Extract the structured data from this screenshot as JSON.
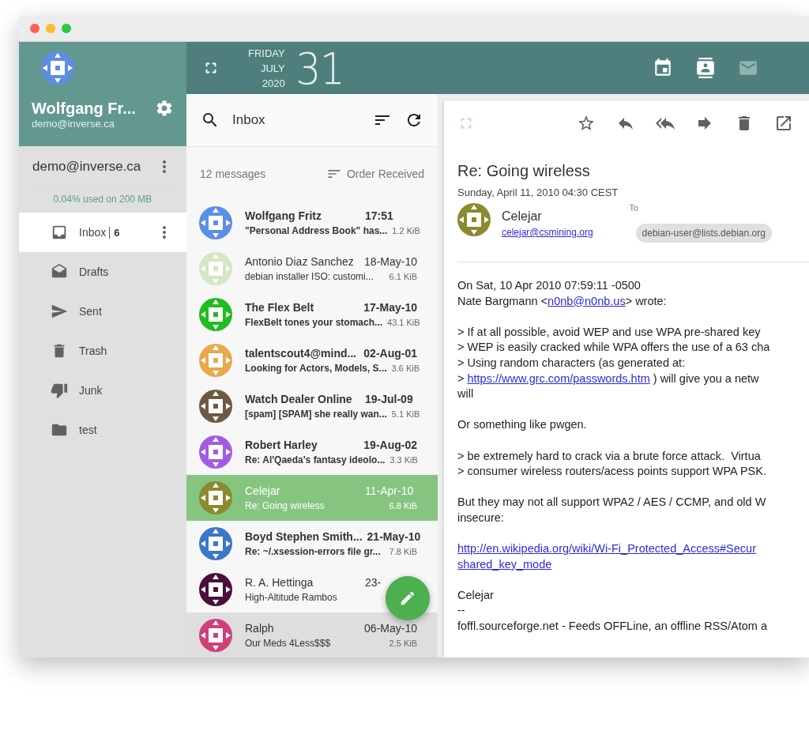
{
  "account_header": {
    "display_name": "Wolfgang Fr...",
    "email": "demo@inverse.ca"
  },
  "calendar": {
    "weekday": "FRIDAY",
    "month": "JULY",
    "year": "2020",
    "day": "31"
  },
  "app_switcher": [
    {
      "kind": "calendar",
      "selected": false
    },
    {
      "kind": "contacts",
      "selected": false
    },
    {
      "kind": "mail",
      "selected": true
    }
  ],
  "account": {
    "name": "demo@inverse.ca",
    "quota": {
      "level": 0.0004,
      "label": "0.04% used on 200 MB"
    }
  },
  "folders": [
    {
      "kind": "inbox",
      "label": "Inbox",
      "count": "6",
      "selected": true
    },
    {
      "kind": "drafts",
      "label": "Drafts",
      "selected": false
    },
    {
      "kind": "sent",
      "label": "Sent",
      "selected": false
    },
    {
      "kind": "trash",
      "label": "Trash",
      "selected": false
    },
    {
      "kind": "junk",
      "label": "Junk",
      "selected": false
    },
    {
      "kind": "folder",
      "label": "test",
      "selected": false
    }
  ],
  "list_toolbar": {
    "title": "Inbox"
  },
  "list_info": {
    "count": "12 messages",
    "sort": "Order Received"
  },
  "messages": [
    {
      "sender": "Wolfgang Fritz",
      "date": "17:51",
      "subject": "\"Personal Address Book\" has...",
      "size": "1.2 KiB",
      "unread": true,
      "selected": false,
      "hovered": false,
      "color": "#5b8ee6"
    },
    {
      "sender": "Antonio Diaz Sanchez",
      "date": "18-May-10",
      "subject": "debian installer ISO: customi...",
      "size": "6.1 KiB",
      "unread": false,
      "selected": false,
      "hovered": false,
      "color": "#d4e6c4"
    },
    {
      "sender": "The Flex Belt",
      "date": "17-May-10",
      "subject": "FlexBelt tones your stomach...",
      "size": "43.1 KiB",
      "unread": true,
      "selected": false,
      "hovered": false,
      "color": "#22bb22"
    },
    {
      "sender": "talentscout4@mind...",
      "date": "02-Aug-01",
      "subject": "Looking for Actors, Models, S...",
      "size": "3.6 KiB",
      "unread": true,
      "selected": false,
      "hovered": false,
      "color": "#e8a84c"
    },
    {
      "sender": "Watch Dealer Online",
      "date": "19-Jul-09",
      "subject": "[spam] [SPAM] she really wan...",
      "size": "5.1 KiB",
      "unread": true,
      "selected": false,
      "hovered": false,
      "color": "#6e5a44"
    },
    {
      "sender": "Robert Harley",
      "date": "19-Aug-02",
      "subject": "Re: Al'Qaeda's fantasy ideolo...",
      "size": "3.3 KiB",
      "unread": true,
      "selected": false,
      "hovered": false,
      "color": "#a35be6"
    },
    {
      "sender": "Celejar",
      "date": "11-Apr-10",
      "subject": "Re: Going wireless",
      "size": "6.8 KiB",
      "unread": false,
      "selected": true,
      "hovered": false,
      "color": "#8a8a2e"
    },
    {
      "sender": "Boyd Stephen Smith...",
      "date": "21-May-10",
      "subject": "Re: ~/.xsession-errors file gr...",
      "size": "7.8 KiB",
      "unread": true,
      "selected": false,
      "hovered": false,
      "color": "#3a78c9"
    },
    {
      "sender": "R. A. Hettinga",
      "date": "23-",
      "subject": "High-Altitude Rambos",
      "unread": false,
      "selected": false,
      "hovered": false,
      "color": "#4a0f3a"
    },
    {
      "sender": "Ralph",
      "date": "06-May-10",
      "subject": "Our Meds 4Less$$$",
      "size": "2.5 KiB",
      "unread": false,
      "selected": false,
      "hovered": true,
      "color": "#d13f78"
    }
  ],
  "reader": {
    "subject": "Re: Going wireless",
    "date": "Sunday, April 11, 2010 04:30 CEST",
    "from": {
      "name": "Celejar",
      "email": "celejar@csmining.org",
      "color": "#8a8a2e"
    },
    "to_label": "To",
    "to": [
      "debian-user@lists.debian.org"
    ],
    "body": [
      [
        [
          {
            "kind": "text",
            "text": "On Sat, 10 Apr 2010 07:59:11 -0500"
          }
        ],
        [
          {
            "kind": "text",
            "text": "Nate Bargmann <"
          },
          {
            "kind": "link",
            "text": "n0nb@n0nb.us"
          },
          {
            "kind": "text",
            "text": "> wrote:"
          }
        ]
      ],
      [
        [
          {
            "kind": "text",
            "text": "> If at all possible, avoid WEP and use WPA pre-shared key"
          }
        ],
        [
          {
            "kind": "text",
            "text": "> WEP is easily cracked while WPA offers the use of a 63 cha"
          }
        ],
        [
          {
            "kind": "text",
            "text": "> Using random characters (as generated at:"
          }
        ],
        [
          {
            "kind": "text",
            "text": "> "
          },
          {
            "kind": "link",
            "text": "https://www.grc.com/passwords.htm"
          },
          {
            "kind": "text",
            "text": " ) will give you a netw"
          }
        ],
        [
          {
            "kind": "text",
            "text": "will"
          }
        ]
      ],
      [
        [
          {
            "kind": "text",
            "text": "Or something like pwgen."
          }
        ]
      ],
      [
        [
          {
            "kind": "text",
            "text": "> be extremely hard to crack via a brute force attack.  Virtua"
          }
        ],
        [
          {
            "kind": "text",
            "text": "> consumer wireless routers/acess points support WPA PSK."
          }
        ]
      ],
      [
        [
          {
            "kind": "text",
            "text": "But they may not all support WPA2 / AES / CCMP, and old W"
          }
        ],
        [
          {
            "kind": "text",
            "text": "insecure:"
          }
        ]
      ],
      [
        [
          {
            "kind": "link",
            "text": "http://en.wikipedia.org/wiki/Wi-Fi_Protected_Access#Secur"
          }
        ],
        [
          {
            "kind": "link",
            "text": "shared_key_mode"
          }
        ]
      ],
      [
        [
          {
            "kind": "text",
            "text": "Celejar"
          }
        ],
        [
          {
            "kind": "text",
            "text": "--"
          }
        ],
        [
          {
            "kind": "text",
            "text": "foffl.sourceforge.net - Feeds OFFLine, an offline RSS/Atom a"
          }
        ]
      ]
    ]
  }
}
